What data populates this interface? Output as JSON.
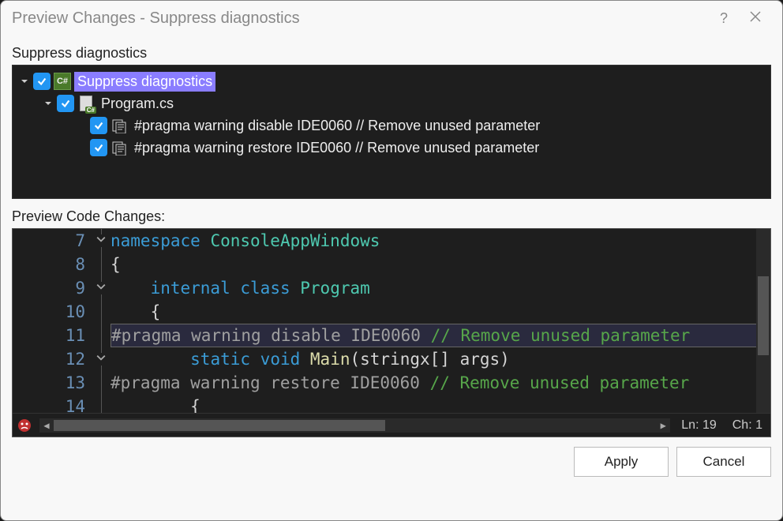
{
  "titlebar": {
    "title": "Preview Changes - Suppress diagnostics"
  },
  "tree": {
    "label": "Suppress diagnostics",
    "root": {
      "label": "Suppress diagnostics",
      "file": {
        "label": "Program.cs",
        "items": [
          "#pragma warning disable IDE0060 // Remove unused parameter",
          "#pragma warning restore IDE0060 // Remove unused parameter"
        ]
      }
    }
  },
  "code": {
    "label": "Preview Code Changes:",
    "lines": [
      {
        "num": 7,
        "fold": "open",
        "tokens": [
          [
            "keyword",
            "namespace"
          ],
          [
            "plain",
            " "
          ],
          [
            "type",
            "ConsoleAppWindows"
          ]
        ]
      },
      {
        "num": 8,
        "fold": "line",
        "tokens": [
          [
            "punct",
            "{"
          ]
        ]
      },
      {
        "num": 9,
        "fold": "open",
        "tokens": [
          [
            "plain",
            "    "
          ],
          [
            "keyword",
            "internal"
          ],
          [
            "plain",
            " "
          ],
          [
            "keyword",
            "class"
          ],
          [
            "plain",
            " "
          ],
          [
            "type",
            "Program"
          ]
        ]
      },
      {
        "num": 10,
        "fold": "line",
        "tokens": [
          [
            "plain",
            "    "
          ],
          [
            "punct",
            "{"
          ]
        ]
      },
      {
        "num": 11,
        "fold": "line",
        "hl": true,
        "tokens": [
          [
            "pragma",
            "#pragma warning disable IDE0060 "
          ],
          [
            "comment",
            "// Remove unused parameter"
          ]
        ]
      },
      {
        "num": 12,
        "fold": "open",
        "tokens": [
          [
            "plain",
            "        "
          ],
          [
            "keyword",
            "static"
          ],
          [
            "plain",
            " "
          ],
          [
            "keyword",
            "void"
          ],
          [
            "plain",
            " "
          ],
          [
            "method",
            "Main"
          ],
          [
            "punct",
            "("
          ],
          [
            "plain",
            "stringx"
          ],
          [
            "punct",
            "[]"
          ],
          [
            "plain",
            " args"
          ],
          [
            "punct",
            ")"
          ]
        ]
      },
      {
        "num": 13,
        "fold": "line",
        "tokens": [
          [
            "pragma",
            "#pragma warning restore IDE0060 "
          ],
          [
            "comment",
            "// Remove unused parameter"
          ]
        ]
      },
      {
        "num": 14,
        "fold": "line",
        "tokens": [
          [
            "plain",
            "        "
          ],
          [
            "punct",
            "{"
          ]
        ]
      }
    ],
    "status": {
      "ln": "Ln: 19",
      "ch": "Ch: 1"
    }
  },
  "buttons": {
    "apply": "Apply",
    "cancel": "Cancel"
  },
  "icons": {
    "cs_badge": "C#"
  }
}
